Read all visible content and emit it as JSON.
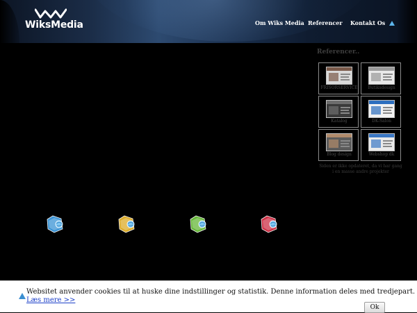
{
  "brand": {
    "name": "WiksMedia"
  },
  "nav": {
    "items": [
      {
        "label": "Om Wiks Media"
      },
      {
        "label": "Referencer"
      },
      {
        "label": "Kontakt Os"
      }
    ],
    "extra_icon": "up-triangle-icon"
  },
  "references": {
    "title": "Referencer..",
    "items": [
      {
        "caption": "FRISORSERVICE",
        "thumb_color": "#d9d9d9",
        "accent": "#7a5a4a"
      },
      {
        "caption": "Butiksdesign",
        "thumb_color": "#e8e8e8",
        "accent": "#9a9a9a"
      },
      {
        "caption": "Katalog",
        "thumb_color": "#3a3a3a",
        "accent": "#6d6d6d"
      },
      {
        "caption": "DK-Salon",
        "thumb_color": "#f2f2f2",
        "accent": "#2d6fbf"
      },
      {
        "caption": "Blog design",
        "thumb_color": "#5b5b5b",
        "accent": "#b08a6a"
      },
      {
        "caption": "Webshop dk",
        "thumb_color": "#eaeaea",
        "accent": "#3a77c4"
      }
    ],
    "note": "Siden er ikke opdateret, da vi har gang i en masse andre projekter"
  },
  "folders": [
    {
      "name": "blue-folder-icon",
      "color": "#3e9be0"
    },
    {
      "name": "yellow-folder-icon",
      "color": "#e8b52a"
    },
    {
      "name": "green-folder-icon",
      "color": "#6cc13c"
    },
    {
      "name": "red-folder-icon",
      "color": "#d8344a"
    }
  ],
  "cookie": {
    "text": "Websitet anvender cookies til at huske dine indstillinger og statistik. Denne information deles med tredjepart.",
    "link": "Læs mere >>",
    "ok": "Ok"
  },
  "colors": {
    "background": "#000000",
    "header_blue": "#2d4a70",
    "accent_blue": "#5db6ec"
  }
}
